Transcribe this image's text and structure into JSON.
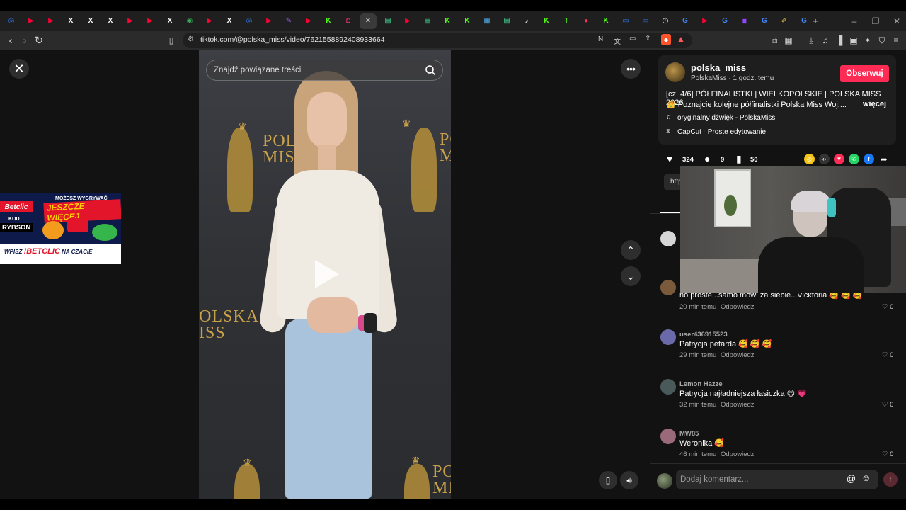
{
  "browser": {
    "url": "tiktok.com/@polska_miss/video/7621558892408933664",
    "tabs": [
      {
        "icon": "messenger-icon",
        "color": "#2f7bf6",
        "glyph": "◎"
      },
      {
        "icon": "youtube-icon",
        "color": "#ff0033",
        "glyph": "▶"
      },
      {
        "icon": "youtube-icon",
        "color": "#ff0033",
        "glyph": "▶"
      },
      {
        "icon": "x-icon",
        "color": "#ffffff",
        "glyph": "X"
      },
      {
        "icon": "x-icon",
        "color": "#ffffff",
        "glyph": "X"
      },
      {
        "icon": "x-icon",
        "color": "#ffffff",
        "glyph": "X"
      },
      {
        "icon": "youtube-icon",
        "color": "#ff0033",
        "glyph": "▶"
      },
      {
        "icon": "youtube-icon",
        "color": "#ff0033",
        "glyph": "▶"
      },
      {
        "icon": "x-icon",
        "color": "#ffffff",
        "glyph": "X"
      },
      {
        "icon": "maps-icon",
        "color": "#34a853",
        "glyph": "◉"
      },
      {
        "icon": "youtube-icon",
        "color": "#ff0033",
        "glyph": "▶"
      },
      {
        "icon": "x-icon",
        "color": "#ffffff",
        "glyph": "X"
      },
      {
        "icon": "messenger-icon",
        "color": "#2f7bf6",
        "glyph": "◎"
      },
      {
        "icon": "youtube-icon",
        "color": "#ff0033",
        "glyph": "▶"
      },
      {
        "icon": "feather-icon",
        "color": "#9c5cf2",
        "glyph": "✎"
      },
      {
        "icon": "youtube-icon",
        "color": "#ff0033",
        "glyph": "▶"
      },
      {
        "icon": "kick-icon",
        "color": "#53fc18",
        "glyph": "K"
      },
      {
        "icon": "instagram-icon",
        "color": "#e1306c",
        "glyph": "◘"
      },
      {
        "icon": "close-icon",
        "color": "#cfcfcf",
        "glyph": "✕",
        "active": true
      },
      {
        "icon": "chart-icon",
        "color": "#3ecf8e",
        "glyph": "▤"
      },
      {
        "icon": "youtube-icon",
        "color": "#ff0033",
        "glyph": "▶"
      },
      {
        "icon": "chart-icon",
        "color": "#3ecf8e",
        "glyph": "▤"
      },
      {
        "icon": "kick-icon",
        "color": "#53fc18",
        "glyph": "K"
      },
      {
        "icon": "kick-icon",
        "color": "#53fc18",
        "glyph": "K"
      },
      {
        "icon": "stats-icon",
        "color": "#4aa3df",
        "glyph": "▦"
      },
      {
        "icon": "chart-icon",
        "color": "#3ecf8e",
        "glyph": "▤"
      },
      {
        "icon": "tiktok-icon",
        "color": "#ffffff",
        "glyph": "♪"
      },
      {
        "icon": "kick-icon",
        "color": "#53fc18",
        "glyph": "K"
      },
      {
        "icon": "tt-icon",
        "color": "#53fc18",
        "glyph": "T"
      },
      {
        "icon": "record-icon",
        "color": "#ff2d55",
        "glyph": "●"
      },
      {
        "icon": "kick-icon",
        "color": "#53fc18",
        "glyph": "K"
      },
      {
        "icon": "box-icon",
        "color": "#2f7bf6",
        "glyph": "▭"
      },
      {
        "icon": "box-icon",
        "color": "#2f7bf6",
        "glyph": "▭"
      },
      {
        "icon": "clock-icon",
        "color": "#ffffff",
        "glyph": "◷"
      },
      {
        "icon": "google-icon",
        "color": "#4285f4",
        "glyph": "G"
      },
      {
        "icon": "youtube-icon",
        "color": "#ff0033",
        "glyph": "▶"
      },
      {
        "icon": "google-icon",
        "color": "#4285f4",
        "glyph": "G"
      },
      {
        "icon": "twitch-icon",
        "color": "#9146ff",
        "glyph": "▣"
      },
      {
        "icon": "google-icon",
        "color": "#4285f4",
        "glyph": "G"
      },
      {
        "icon": "brush-icon",
        "color": "#f5c542",
        "glyph": "✐"
      },
      {
        "icon": "google-icon",
        "color": "#4285f4",
        "glyph": "G"
      }
    ]
  },
  "video": {
    "search_placeholder": "Znajdź powiązane treści",
    "logo_line1": "POL",
    "logo_line2": "MISS",
    "logo_left1": "OLSKA",
    "logo_left2": "ISS",
    "logo_bottom1": "PO",
    "logo_bottom2": "MISS"
  },
  "ad": {
    "headline_small": "MOŻESZ WYGRYWAĆ",
    "headline_big": "JESZCZE WIĘCEJ",
    "brand": "Betclic",
    "code_label": "KOD",
    "code": "RYBSON",
    "cta_pre": "WPISZ",
    "cta_code": "!BETCLIC",
    "cta_post": "NA CZACIE"
  },
  "post": {
    "username": "polska_miss",
    "subline": "PolskaMiss · 1 godz. temu",
    "follow_label": "Obserwuj",
    "description_line1": "[cz. 4/6] PÓŁFINALISTKI | WIELKOPOLSKIE | POLSKA MISS 2026",
    "description_line2": "👑 Poznajcie kolejne półfinalistki Polska Miss Woj....",
    "more_label": "więcej",
    "music": "oryginalny dźwięk - PolskaMiss",
    "capcut": "CapCut · Proste edytowanie",
    "likes": "324",
    "comments": "9",
    "saves": "50",
    "link_chip": "http"
  },
  "comments": [
    {
      "user": "",
      "text": "no proste...samo mówi za siebie...Vicktoria 🥰 🥰 🥰",
      "time": "20 min temu",
      "reply": "Odpowiedz",
      "likes": "0",
      "avatar_color": "#7a5a3a"
    },
    {
      "user": "user436915523",
      "text": "Patrycja petarda 🥰 🥰 🥰",
      "time": "29 min temu",
      "reply": "Odpowiedz",
      "likes": "0",
      "avatar_color": "#6a6aaa"
    },
    {
      "user": "Lemon Hazze",
      "text": "Patrycja najładniejsza łasiczka 😍 💗",
      "time": "32 min temu",
      "reply": "Odpowiedz",
      "likes": "0",
      "avatar_color": "#4a5a5a"
    },
    {
      "user": "MW85",
      "text": "Weronika 🥰",
      "time": "46 min temu",
      "reply": "Odpowiedz",
      "likes": "0",
      "avatar_color": "#9a6a7a"
    }
  ],
  "comment_box": {
    "placeholder": "Dodaj komentarz..."
  },
  "colors": {
    "accent": "#fe2c55",
    "gold": "#c9a24a"
  }
}
